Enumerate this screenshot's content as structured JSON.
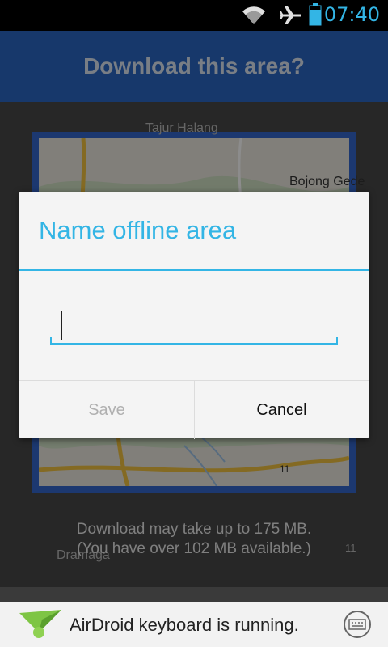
{
  "status_bar": {
    "time": "07:40",
    "icons": [
      "wifi-icon",
      "airplane-mode-icon",
      "battery-icon"
    ],
    "accent": "#33b5e5"
  },
  "background_app": {
    "title": "Download this area?",
    "header_color": "#2a67c4",
    "map_labels": {
      "place_1": "Tajur Halang",
      "place_2": "Bojong Gede",
      "place_3": "Dramaga",
      "road_shield_1": "11",
      "road_shield_2": "11"
    },
    "info_line_1": "Download may take up to 175 MB.",
    "info_line_2": "(You have over 102 MB available.)"
  },
  "dialog": {
    "title": "Name offline area",
    "input_value": "",
    "save_label": "Save",
    "cancel_label": "Cancel",
    "accent": "#33b5e5"
  },
  "notification": {
    "text": "AirDroid keyboard is running.",
    "app_icon": "airdroid-icon",
    "action_icon": "keyboard-icon"
  }
}
